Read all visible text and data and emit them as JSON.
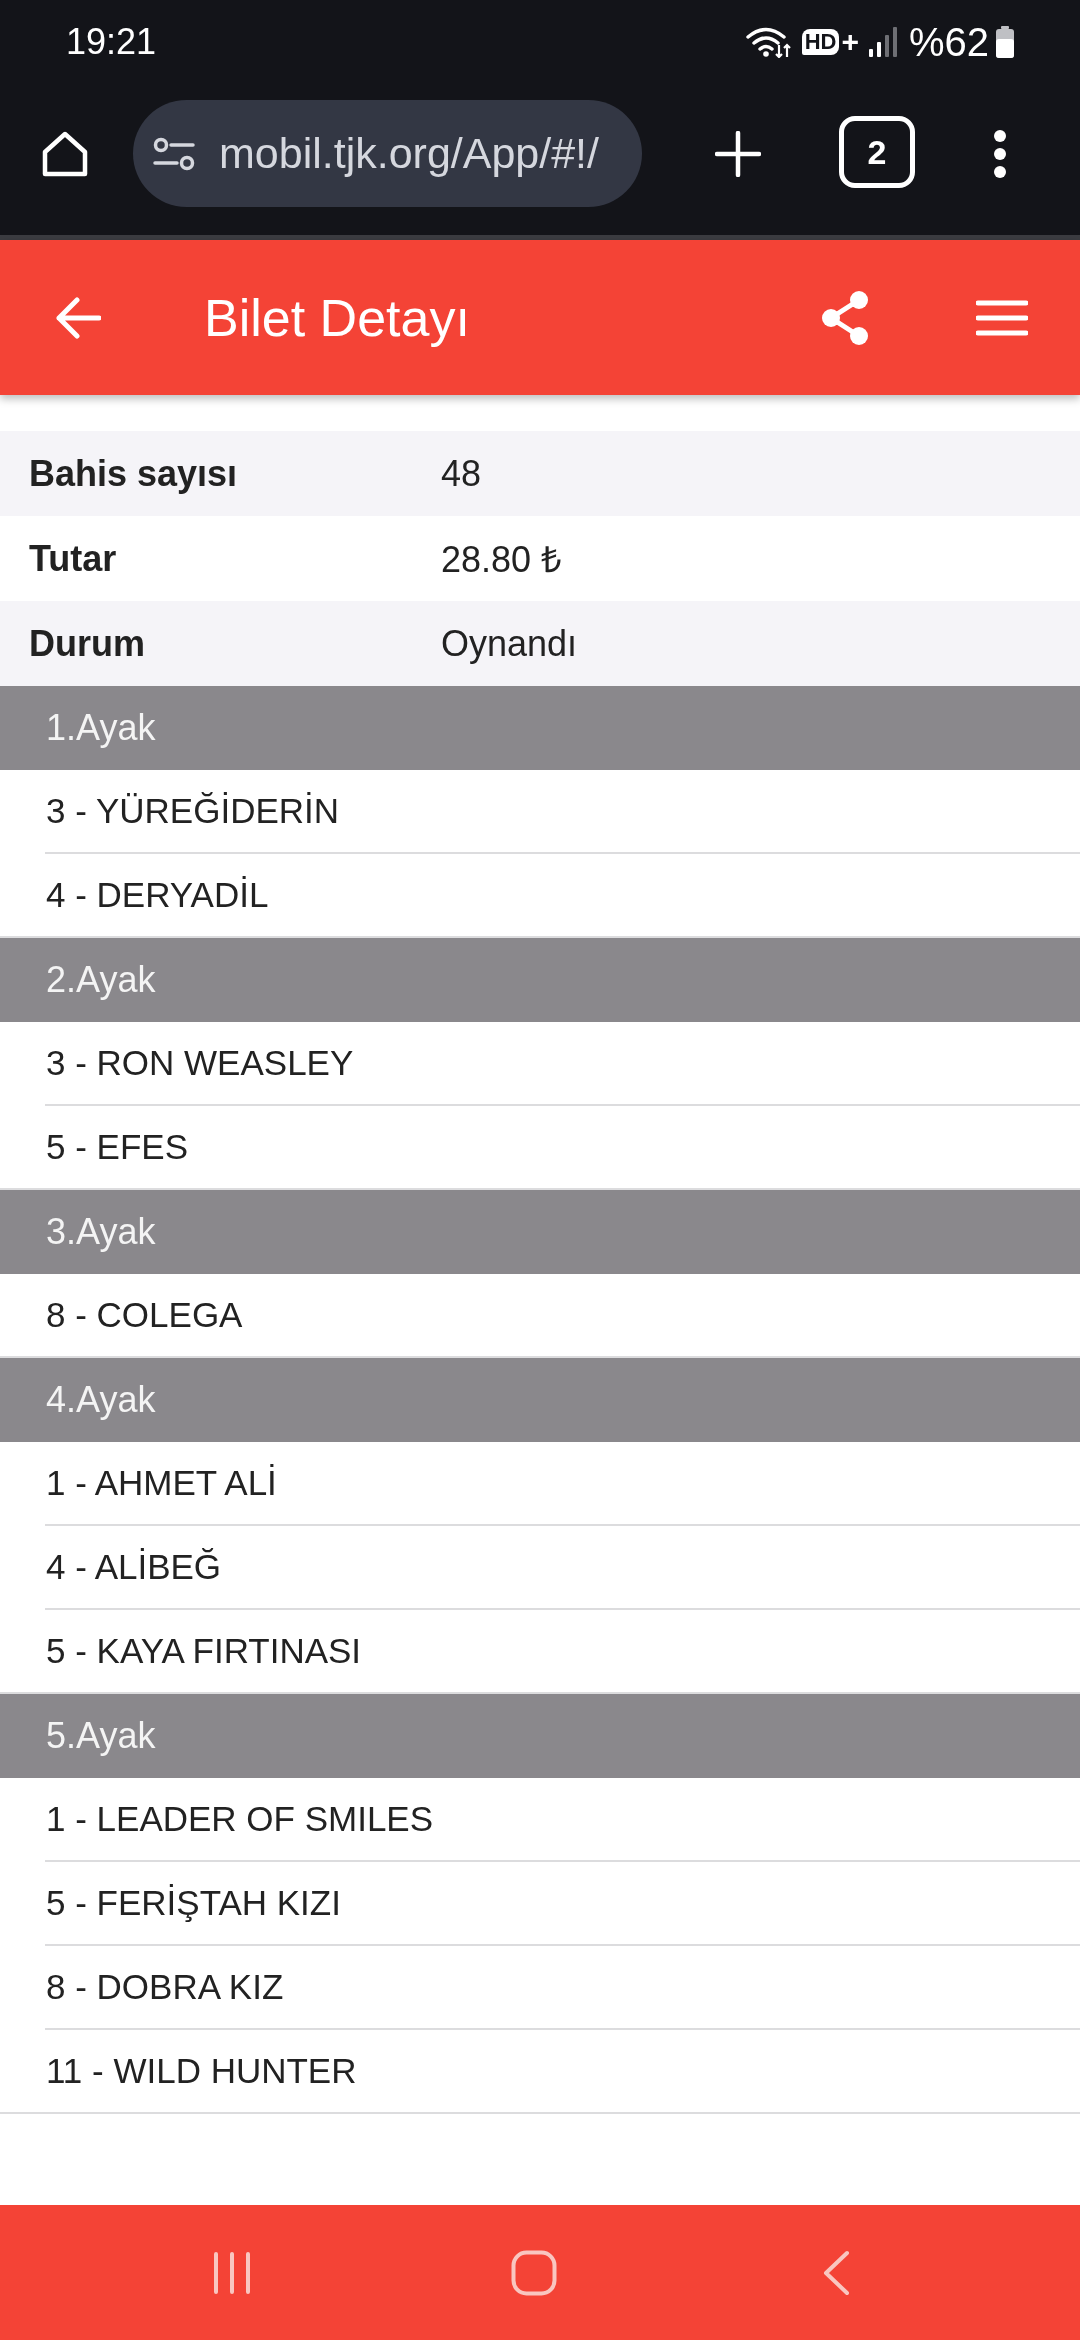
{
  "status_bar": {
    "time": "19:21",
    "hd_badge": "HD",
    "hd_suffix": "+",
    "battery": "%62"
  },
  "browser": {
    "url": "mobil.tjk.org/App/#!/",
    "tab_count": "2"
  },
  "app_bar": {
    "title": "Bilet Detayı"
  },
  "details": [
    {
      "label": "Bahis sayısı",
      "value": "48"
    },
    {
      "label": "Tutar",
      "value": "28.80 ₺"
    },
    {
      "label": "Durum",
      "value": "Oynandı"
    }
  ],
  "legs": [
    {
      "title": "1.Ayak",
      "horses": [
        "3 - YÜREĞİDERİN",
        "4 - DERYADİL"
      ]
    },
    {
      "title": "2.Ayak",
      "horses": [
        "3 - RON WEASLEY",
        "5 - EFES"
      ]
    },
    {
      "title": "3.Ayak",
      "horses": [
        "8 - COLEGA"
      ]
    },
    {
      "title": "4.Ayak",
      "horses": [
        "1 - AHMET ALİ",
        "4 - ALİBEĞ",
        "5 - KAYA FIRTINASI"
      ]
    },
    {
      "title": "5.Ayak",
      "horses": [
        "1 - LEADER OF SMILES",
        "5 - FERİŞTAH KIZI",
        "8 - DOBRA KIZ",
        "11 - WILD HUNTER"
      ]
    }
  ]
}
